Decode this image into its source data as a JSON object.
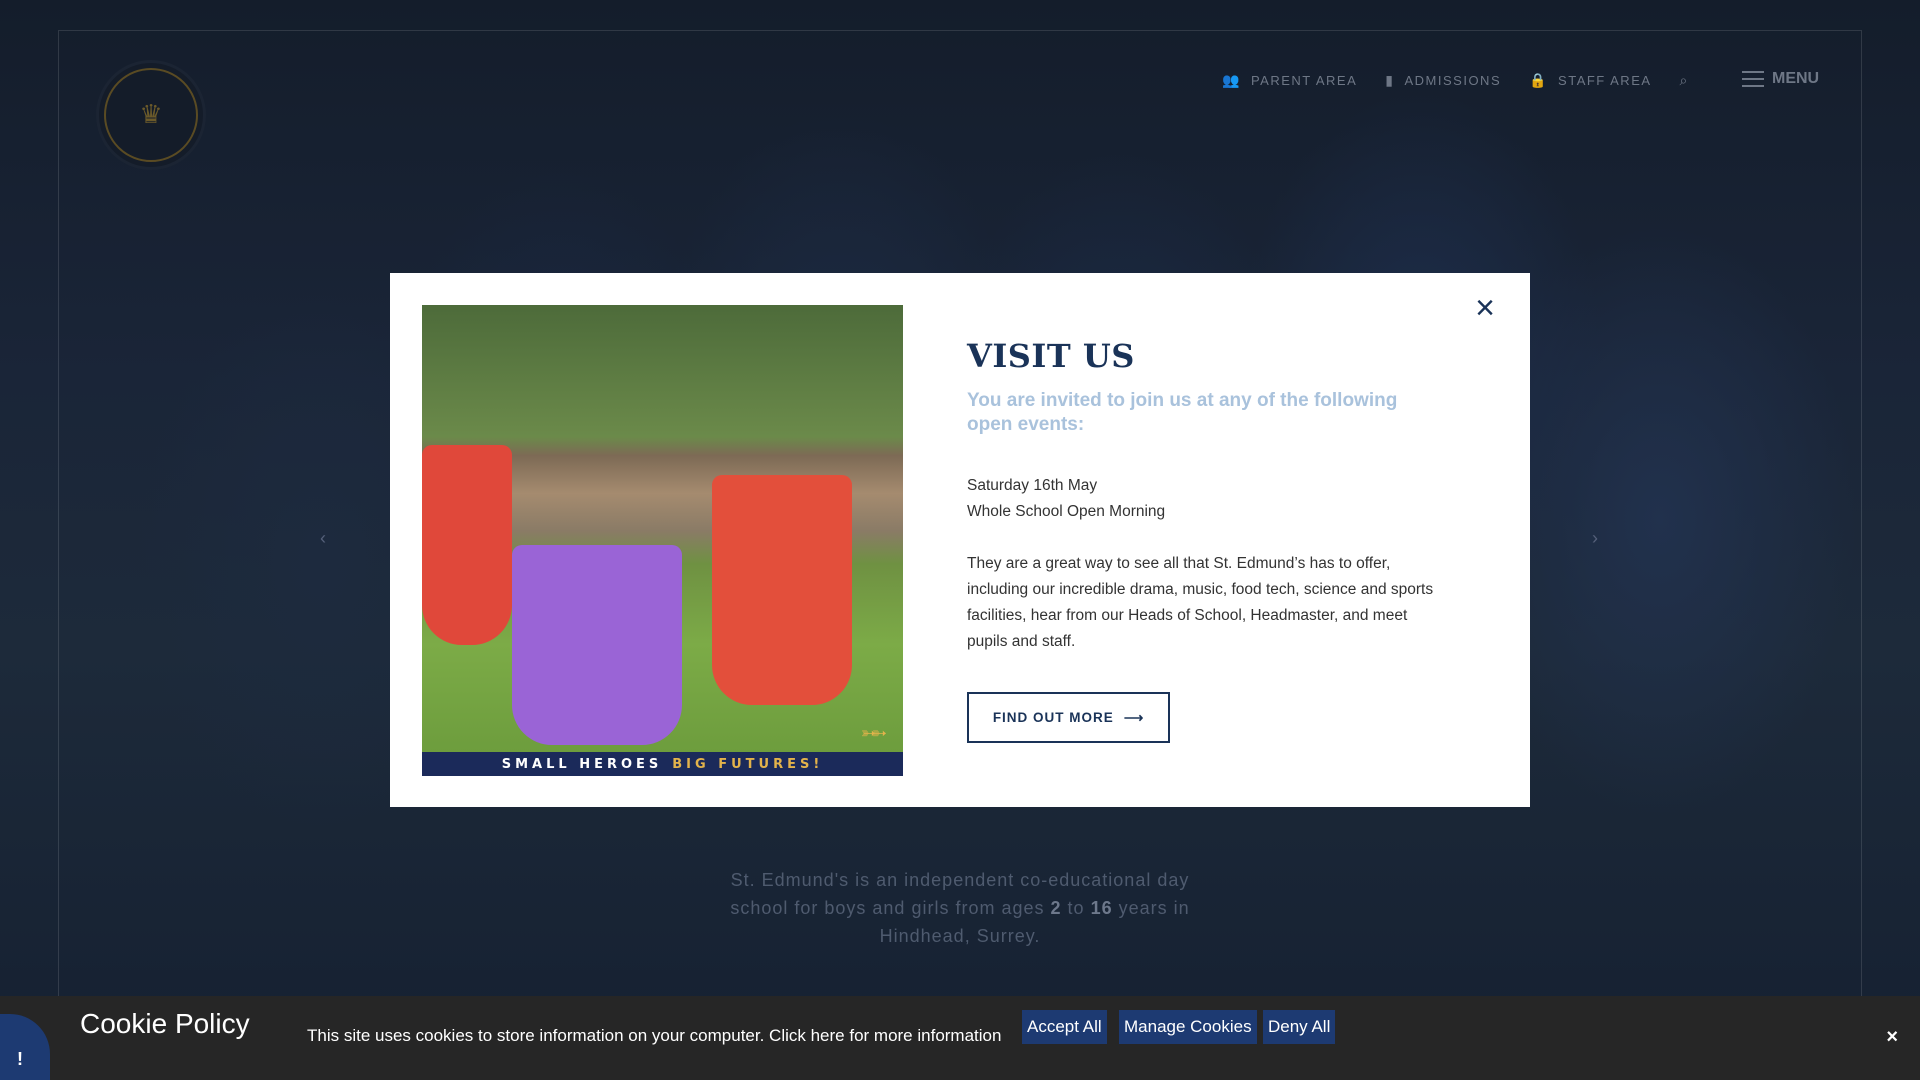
{
  "nav": {
    "parent_area": "PARENT AREA",
    "admissions": "ADMISSIONS",
    "staff_area": "STAFF AREA",
    "menu": "MENU"
  },
  "hero": {
    "intro_pre": "St. Edmund's is an independent co-educational day school for boys and girls from ages",
    "age_from": "2",
    "intro_mid": "to",
    "age_to": "16",
    "intro_post": "years in Hindhead, Surrey."
  },
  "modal": {
    "image_banner_left": "SMALL HEROES",
    "image_banner_right": "BIG FUTURES!",
    "close_label": "×",
    "title": "VISIT US",
    "subtitle": "You are invited to join us at any of the following open events:",
    "event_date": "Saturday 16th May",
    "event_name": "Whole School Open Morning",
    "body": "They are a great way to see all that St. Edmund’s has to offer, including our incredible drama, music, food tech, science and sports facilities, hear from our Heads of School, Headmaster, and meet pupils and staff.",
    "button_label": "FIND OUT MORE"
  },
  "cookie": {
    "badge": "!",
    "title": "Cookie Policy",
    "text": "This site uses cookies to store information on your computer. Click here for more information",
    "accept": "Accept All",
    "manage": "Manage Cookies",
    "deny": "Deny All",
    "close": "×"
  },
  "colors": {
    "brand_navy": "#1a3358",
    "subtitle_blue": "#a9c2dc",
    "cookie_button": "#1d3a72"
  }
}
